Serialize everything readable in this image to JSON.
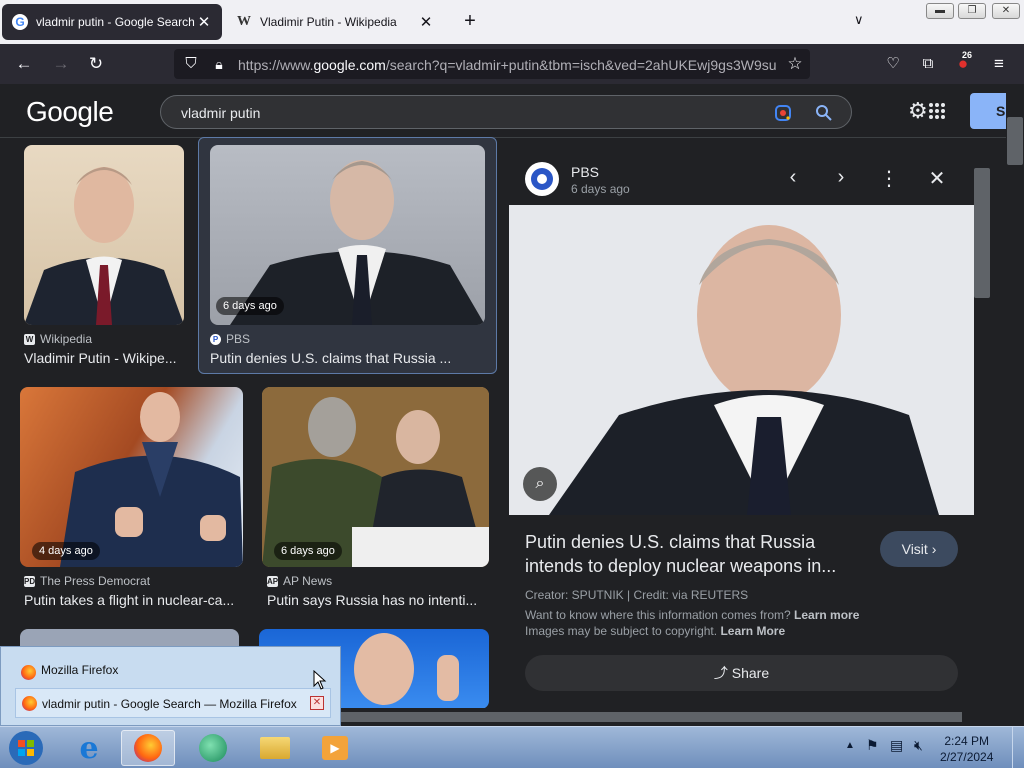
{
  "tabs": [
    {
      "title": "vladmir putin - Google Search",
      "favicon": "G"
    },
    {
      "title": "Vladimir Putin - Wikipedia",
      "favicon": "W"
    }
  ],
  "url": {
    "prefix": "https://www.",
    "domain": "google.com",
    "rest": "/search?q=vladmir+putin&tbm=isch&ved=2ahUKEwj9gs3W9su"
  },
  "extensions_badge": "26",
  "google": {
    "logo": "Google",
    "query": "vladmir putin",
    "signin_label": "Si"
  },
  "results": [
    {
      "source": "Wikipedia",
      "source_icon": "W",
      "title": "Vladimir Putin - Wikipe...",
      "age": ""
    },
    {
      "source": "PBS",
      "source_icon": "P",
      "title": "Putin denies U.S. claims that Russia ...",
      "age": "6 days ago"
    },
    {
      "source": "The Press Democrat",
      "source_icon": "PD",
      "title": "Putin takes a flight in nuclear-ca...",
      "age": "4 days ago"
    },
    {
      "source": "AP News",
      "source_icon": "AP",
      "title": "Putin says Russia has no intenti...",
      "age": "6 days ago"
    }
  ],
  "panel": {
    "source": "PBS",
    "date": "6 days ago",
    "title": "Putin denies U.S. claims that Russia intends to deploy nuclear weapons in...",
    "visit_label": "Visit",
    "creator": "Creator: SPUTNIK | Credit: via REUTERS",
    "info_text": "Want to know where this information comes from?",
    "learn_more_1": "Learn more",
    "copyright_text": "Images may be subject to copyright.",
    "learn_more_2": "Learn More",
    "share_label": "Share"
  },
  "taskbar": {
    "popup_title": "Mozilla Firefox",
    "popup_item": "vladmir putin - Google Search — Mozilla Firefox",
    "time": "2:24 PM",
    "date": "2/27/2024"
  },
  "colors": {
    "accent": "#8ab4f8",
    "panel_bg": "#202124",
    "selected_border": "#5d7aa7"
  }
}
